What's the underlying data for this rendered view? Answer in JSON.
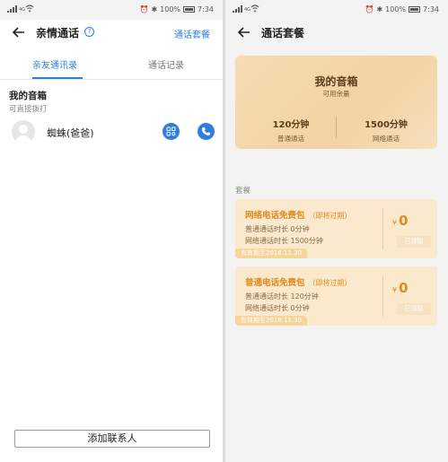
{
  "status_bar": {
    "network": "4G",
    "battery": "100%",
    "time": "7:34"
  },
  "left_screen": {
    "title": "亲情通话",
    "help_icon": "question-icon",
    "plan_link": "通话套餐",
    "tabs": [
      {
        "label": "亲友通讯录",
        "active": true
      },
      {
        "label": "通话记录",
        "active": false
      }
    ],
    "section_title": "我的音箱",
    "section_subtitle": "可直接拨打",
    "contacts": [
      {
        "name": "蜘蛛(爸爸)"
      }
    ],
    "add_button": "添加联系人"
  },
  "right_screen": {
    "title": "通话套餐",
    "card": {
      "name": "我的音箱",
      "subtitle": "可用余量",
      "stats": [
        {
          "value": "120分钟",
          "label": "普通通话"
        },
        {
          "value": "1500分钟",
          "label": "网络通话"
        }
      ]
    },
    "packages_heading": "套餐",
    "packages": [
      {
        "title": "网络电话免费包",
        "note": "（即将过期）",
        "lines": [
          "普通通话时长 0分钟",
          "网络通话时长 1500分钟"
        ],
        "currency": "¥",
        "price": "0",
        "status": "已领取",
        "expiry": "有效期至2018.11.30"
      },
      {
        "title": "普通电话免费包",
        "note": "（即将过期）",
        "lines": [
          "普通通话时长 120分钟",
          "网络通话时长 0分钟"
        ],
        "currency": "¥",
        "price": "0",
        "status": "已领取",
        "expiry": "有效期至2018.11.30"
      }
    ]
  },
  "colors": {
    "accent": "#2f7de0",
    "card_gold": "#f3d2a3",
    "package_orange": "#e08a1e",
    "package_bg": "#fbe9cd"
  }
}
